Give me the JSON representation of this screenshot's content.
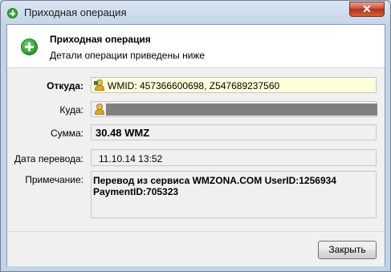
{
  "window": {
    "title": "Приходная операция",
    "close_glyph": "✕"
  },
  "header": {
    "title": "Приходная операция",
    "subtitle": "Детали операции приведены ниже",
    "icon": "plus-circle-icon"
  },
  "fields": {
    "from": {
      "label": "Откуда:",
      "value": "WMID: 457366600698, Z547689237560",
      "icon": "webmoney-user-icon"
    },
    "to": {
      "label": "Куда:",
      "value": "",
      "icon": "webmoney-user-icon"
    },
    "amount": {
      "label": "Сумма:",
      "value": "30.48 WMZ"
    },
    "date": {
      "label": "Дата перевода:",
      "value": "11.10.14 13:52"
    },
    "note": {
      "label": "Примечание:",
      "value": "Перевод из сервиса WMZONA.COM UserID:1256934\nPaymentID:705323"
    }
  },
  "footer": {
    "close_label": "Закрыть"
  },
  "colors": {
    "highlight_field": "#ffffdc",
    "masked": "#808080",
    "close_button_red": "#c9503a"
  }
}
